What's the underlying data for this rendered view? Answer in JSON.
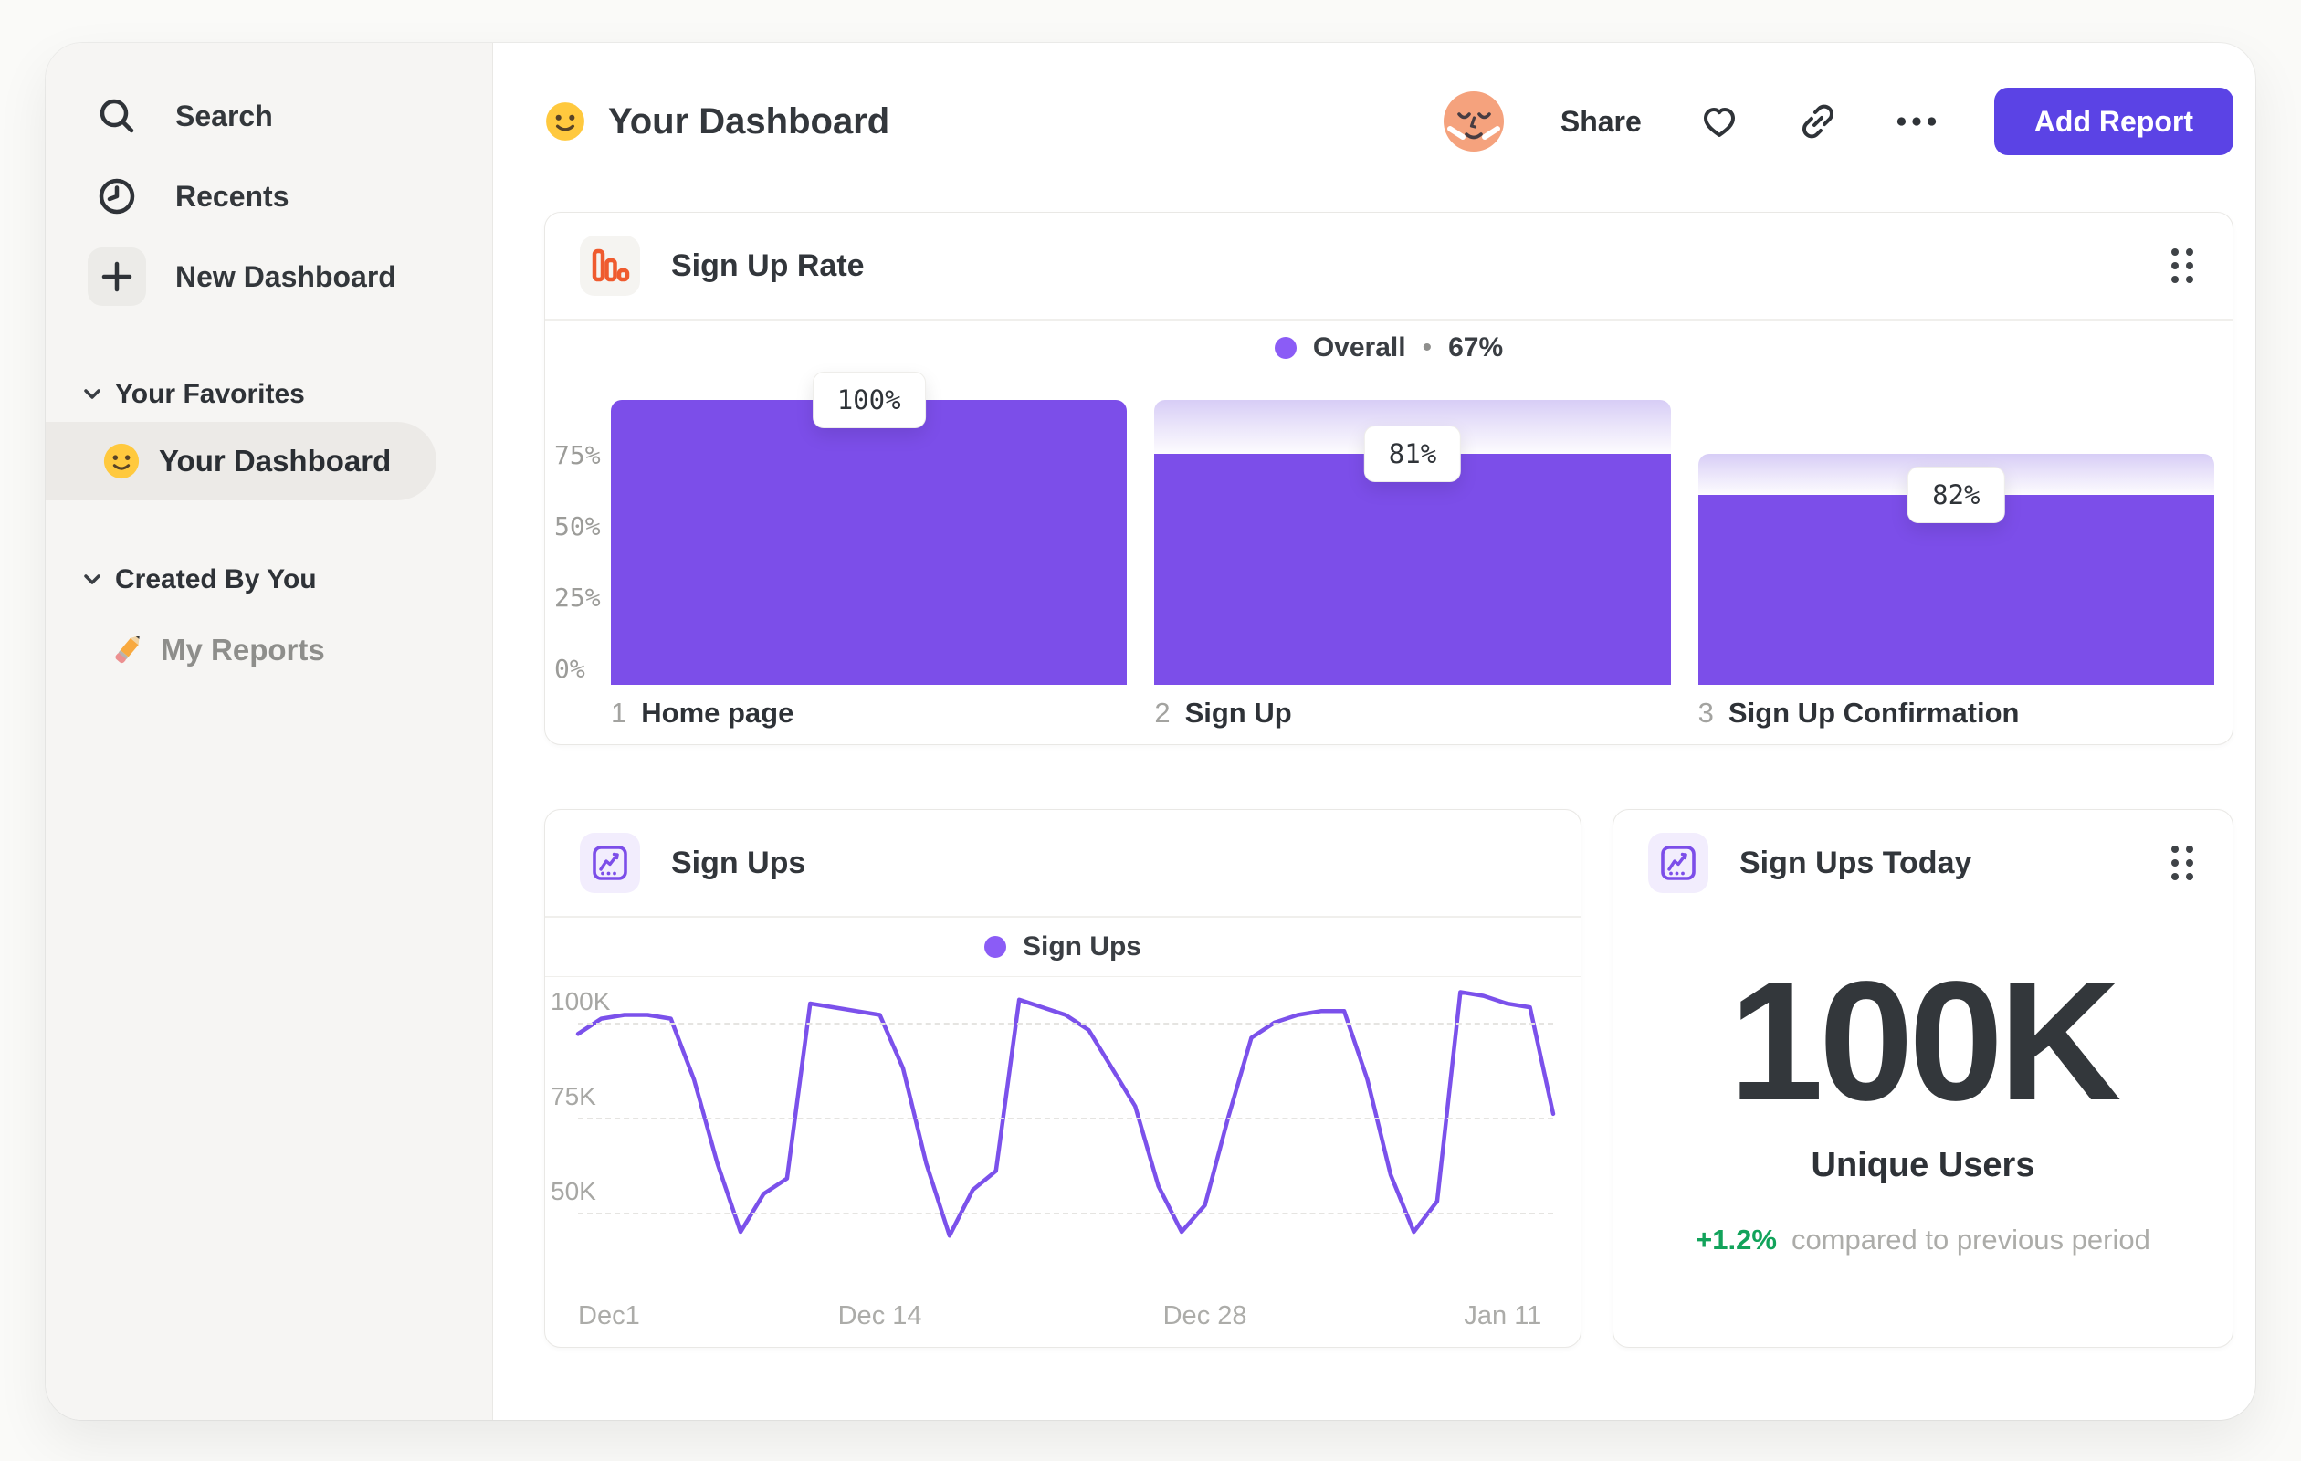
{
  "header": {
    "title": "Your Dashboard",
    "share_label": "Share",
    "add_report_label": "Add Report"
  },
  "sidebar": {
    "items": [
      {
        "label": "Search",
        "icon": "search"
      },
      {
        "label": "Recents",
        "icon": "clock"
      },
      {
        "label": "New Dashboard",
        "icon": "plus"
      }
    ],
    "sections": [
      {
        "title": "Your Favorites",
        "items": [
          {
            "label": "Your Dashboard",
            "icon": "smiley",
            "selected": true
          }
        ]
      },
      {
        "title": "Created By You",
        "items": [
          {
            "label": "My Reports",
            "icon": "pencil",
            "selected": false
          }
        ]
      }
    ]
  },
  "cards": {
    "signup_rate": {
      "title": "Sign Up Rate"
    },
    "signups": {
      "title": "Sign Ups"
    },
    "signups_today": {
      "title": "Sign Ups Today",
      "metric": "100K",
      "metric_label": "Unique Users",
      "delta": "+1.2%",
      "delta_caption": "compared to previous period"
    }
  },
  "chart_data": [
    {
      "id": "signup-rate-funnel",
      "type": "bar",
      "title": "Sign Up Rate",
      "legend": {
        "series": "Overall",
        "separator": "•",
        "value": "67%"
      },
      "ylim": [
        0,
        100
      ],
      "y_ticks": [
        {
          "label": "75%",
          "value": 75
        },
        {
          "label": "50%",
          "value": 50
        },
        {
          "label": "25%",
          "value": 25
        },
        {
          "label": "0%",
          "value": 0
        }
      ],
      "steps": [
        {
          "index": "1",
          "label": "Home page",
          "tooltip": "100%",
          "conversion_pct": 100,
          "cumulative_pct": 100
        },
        {
          "index": "2",
          "label": "Sign Up",
          "tooltip": "81%",
          "conversion_pct": 81,
          "cumulative_pct": 81
        },
        {
          "index": "3",
          "label": "Sign Up Confirmation",
          "tooltip": "82%",
          "conversion_pct": 82,
          "cumulative_pct": 66.4
        }
      ],
      "bar_color": "#7C4EE9",
      "legend_dot_color": "#8B5CF6"
    },
    {
      "id": "signups-line",
      "type": "line",
      "title": "Sign Ups",
      "legend": {
        "series": "Sign Ups"
      },
      "unit": "K",
      "ylim": [
        40,
        112
      ],
      "grid": "dashed-horizontal",
      "y_ticks": [
        {
          "label": "100K",
          "value": 100
        },
        {
          "label": "75K",
          "value": 75
        },
        {
          "label": "50K",
          "value": 50
        }
      ],
      "x_ticks": [
        {
          "label": "Dec1",
          "day": 0
        },
        {
          "label": "Dec 14",
          "day": 13
        },
        {
          "label": "Dec 28",
          "day": 27
        },
        {
          "label": "Jan 11",
          "day": 41
        }
      ],
      "x_domain_days": 42,
      "values": [
        97,
        101,
        102,
        102,
        101,
        85,
        63,
        45,
        55,
        59,
        105,
        104,
        103,
        102,
        88,
        63,
        44,
        56,
        61,
        106,
        104,
        102,
        98,
        88,
        78,
        57,
        45,
        52,
        75,
        96,
        100,
        102,
        103,
        103,
        85,
        60,
        45,
        53,
        108,
        107,
        105,
        104,
        76
      ],
      "line_color": "#7B51EB"
    }
  ],
  "colors": {
    "accent_purple": "#7C4EE9",
    "button_purple": "#5B43E5",
    "legend_dot": "#8B5CF6",
    "funnel_icon_orange": "#EF5B2F",
    "delta_green": "#12A35B",
    "sidebar_bg": "#F6F5F3",
    "card_border": "#E9E8E5"
  }
}
